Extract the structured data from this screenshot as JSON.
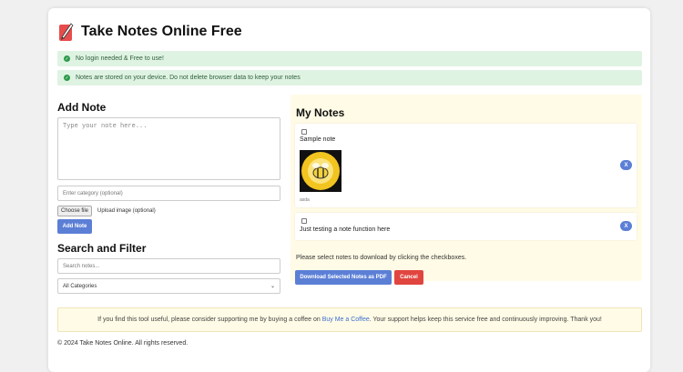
{
  "header": {
    "title": "Take Notes Online Free",
    "logo_icon": "feather-pen-icon"
  },
  "notices": [
    {
      "text": "No login needed & Free to use!"
    },
    {
      "text": "Notes are stored on your device. Do not delete browser data to keep your notes"
    }
  ],
  "add_note": {
    "heading": "Add Note",
    "textarea_placeholder": "Type your note here...",
    "category_placeholder": "Enter category (optional)",
    "file_button": "Choose file",
    "file_label": "Upload image (optional)",
    "add_button": "Add Note"
  },
  "search": {
    "heading": "Search and Filter",
    "search_placeholder": "Search notes...",
    "category_select": "All Categories"
  },
  "my_notes": {
    "heading": "My Notes",
    "notes": [
      {
        "text": "Sample note",
        "image_caption": "asda"
      },
      {
        "text": "Just testing a note function here"
      }
    ],
    "delete_label": "X",
    "instructions": "Please select notes to download by clicking the checkboxes.",
    "download_button": "Download Selected Notes as PDF",
    "cancel_button": "Cancel"
  },
  "support": {
    "before": "If you find this tool useful, please consider supporting me by buying a coffee on ",
    "link": "Buy Me a Coffee",
    "after": ". Your support helps keep this service free and continuously improving. Thank you!"
  },
  "footer": {
    "text": "© 2024 Take Notes Online. All rights reserved."
  },
  "colors": {
    "primary": "#5c7fd6",
    "cancel": "#e0453f",
    "success_bg": "#dff3e3",
    "note_bg": "#fffbe6"
  }
}
